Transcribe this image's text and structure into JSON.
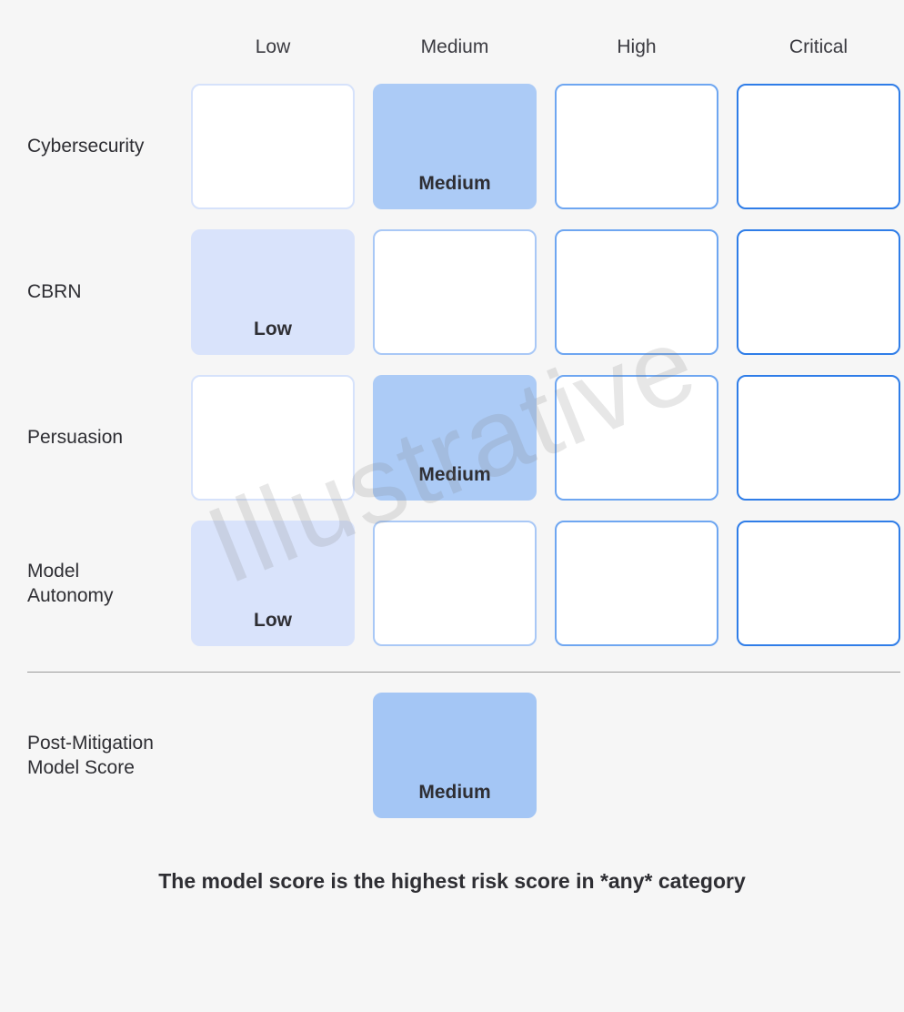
{
  "columns": [
    "Low",
    "Medium",
    "High",
    "Critical"
  ],
  "rows": [
    {
      "label": "Cybersecurity",
      "selected": 1,
      "selected_text": "Medium"
    },
    {
      "label": "CBRN",
      "selected": 0,
      "selected_text": "Low"
    },
    {
      "label": "Persuasion",
      "selected": 1,
      "selected_text": "Medium"
    },
    {
      "label": "Model Autonomy",
      "selected": 0,
      "selected_text": "Low"
    }
  ],
  "score_row": {
    "label": "Post-Mitigation Model Score",
    "selected": 1,
    "selected_text": "Medium"
  },
  "caption": "The model score is the highest risk score in *any* category",
  "watermark": "Illustrative",
  "chart_data": {
    "type": "table",
    "levels": [
      "Low",
      "Medium",
      "High",
      "Critical"
    ],
    "categories": [
      {
        "name": "Cybersecurity",
        "score": "Medium"
      },
      {
        "name": "CBRN",
        "score": "Low"
      },
      {
        "name": "Persuasion",
        "score": "Medium"
      },
      {
        "name": "Model Autonomy",
        "score": "Low"
      }
    ],
    "post_mitigation_model_score": "Medium",
    "rule": "The model score is the highest risk score in *any* category"
  }
}
